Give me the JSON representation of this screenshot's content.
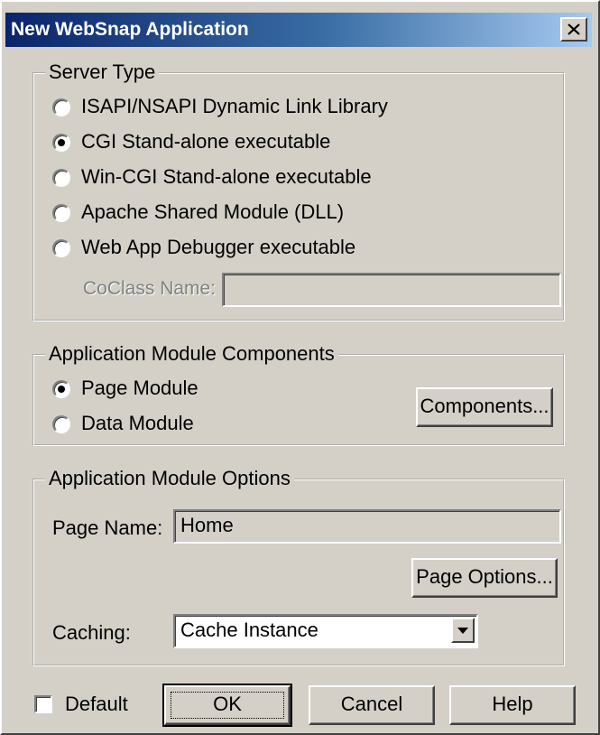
{
  "window": {
    "title": "New WebSnap Application"
  },
  "server_type": {
    "legend": "Server Type",
    "options": [
      {
        "label": "ISAPI/NSAPI Dynamic Link Library",
        "checked": false
      },
      {
        "label": "CGI Stand-alone executable",
        "checked": true
      },
      {
        "label": "Win-CGI Stand-alone executable",
        "checked": false
      },
      {
        "label": "Apache Shared Module (DLL)",
        "checked": false
      },
      {
        "label": "Web App Debugger executable",
        "checked": false
      }
    ],
    "coclass_label": "CoClass Name:",
    "coclass_value": ""
  },
  "components": {
    "legend": "Application Module Components",
    "options": [
      {
        "label": "Page Module",
        "checked": true
      },
      {
        "label": "Data Module",
        "checked": false
      }
    ],
    "button_label": "Components..."
  },
  "options": {
    "legend": "Application Module Options",
    "page_name_label": "Page Name:",
    "page_name_value": "Home",
    "page_options_button": "Page Options...",
    "caching_label": "Caching:",
    "caching_value": "Cache Instance"
  },
  "footer": {
    "default_label": "Default",
    "default_checked": false,
    "ok_label": "OK",
    "cancel_label": "Cancel",
    "help_label": "Help"
  }
}
